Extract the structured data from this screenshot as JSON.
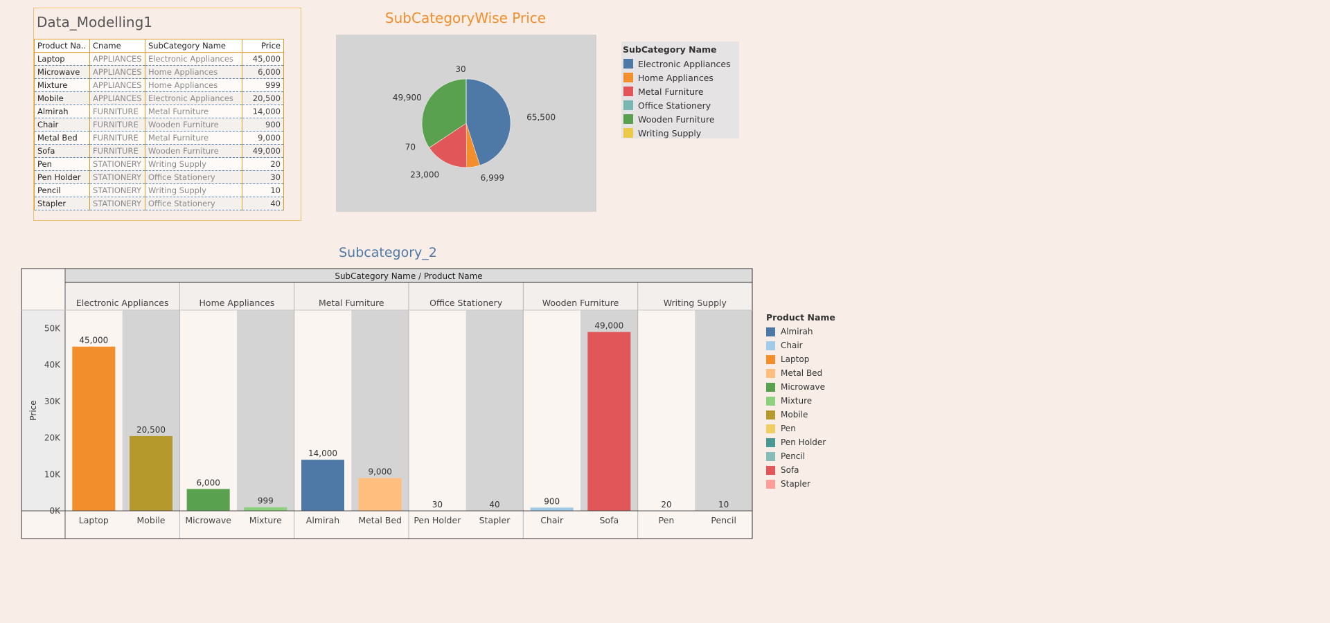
{
  "table": {
    "title": "Data_Modelling1",
    "columns": [
      "Product Na..",
      "Cname",
      "SubCategory Name",
      "Price"
    ],
    "rows": [
      [
        "Laptop",
        "APPLIANCES",
        "Electronic Appliances",
        "45,000"
      ],
      [
        "Microwave",
        "APPLIANCES",
        "Home Appliances",
        "6,000"
      ],
      [
        "Mixture",
        "APPLIANCES",
        "Home Appliances",
        "999"
      ],
      [
        "Mobile",
        "APPLIANCES",
        "Electronic Appliances",
        "20,500"
      ],
      [
        "Almirah",
        "FURNITURE",
        "Metal Furniture",
        "14,000"
      ],
      [
        "Chair",
        "FURNITURE",
        "Wooden Furniture",
        "900"
      ],
      [
        "Metal Bed",
        "FURNITURE",
        "Metal Furniture",
        "9,000"
      ],
      [
        "Sofa",
        "FURNITURE",
        "Wooden Furniture",
        "49,000"
      ],
      [
        "Pen",
        "STATIONERY",
        "Writing Supply",
        "20"
      ],
      [
        "Pen Holder",
        "STATIONERY",
        "Office Stationery",
        "30"
      ],
      [
        "Pencil",
        "STATIONERY",
        "Writing Supply",
        "10"
      ],
      [
        "Stapler",
        "STATIONERY",
        "Office Stationery",
        "40"
      ]
    ]
  },
  "pie": {
    "title": "SubCategoryWise Price",
    "legend_title": "SubCategory Name",
    "legend": [
      {
        "name": "Electronic Appliances",
        "color": "#4e79a7"
      },
      {
        "name": "Home Appliances",
        "color": "#f28e2b"
      },
      {
        "name": "Metal Furniture",
        "color": "#e15759"
      },
      {
        "name": "Office Stationery",
        "color": "#76b7b2"
      },
      {
        "name": "Wooden Furniture",
        "color": "#59a14f"
      },
      {
        "name": "Writing Supply",
        "color": "#edc948"
      }
    ]
  },
  "bars": {
    "title": "Subcategory_2",
    "header": "SubCategory Name  /  Product Name",
    "legend_title": "Product Name",
    "legend": [
      {
        "name": "Almirah",
        "color": "#4e79a7"
      },
      {
        "name": "Chair",
        "color": "#a0cbe8"
      },
      {
        "name": "Laptop",
        "color": "#f28e2b"
      },
      {
        "name": "Metal Bed",
        "color": "#ffbe7d"
      },
      {
        "name": "Microwave",
        "color": "#59a14f"
      },
      {
        "name": "Mixture",
        "color": "#8cd17d"
      },
      {
        "name": "Mobile",
        "color": "#b6992d"
      },
      {
        "name": "Pen",
        "color": "#f1ce63"
      },
      {
        "name": "Pen Holder",
        "color": "#499894"
      },
      {
        "name": "Pencil",
        "color": "#86bcb6"
      },
      {
        "name": "Sofa",
        "color": "#e15759"
      },
      {
        "name": "Stapler",
        "color": "#ff9d9a"
      }
    ]
  },
  "chart_data": [
    {
      "type": "pie",
      "title": "SubCategoryWise Price",
      "legend_title": "SubCategory Name",
      "slices": [
        {
          "name": "Electronic Appliances",
          "value": 65500,
          "label": "65,500",
          "color": "#4e79a7"
        },
        {
          "name": "Home Appliances",
          "value": 6999,
          "label": "6,999",
          "color": "#f28e2b"
        },
        {
          "name": "Metal Furniture",
          "value": 23000,
          "label": "23,000",
          "color": "#e15759"
        },
        {
          "name": "Office Stationery",
          "value": 70,
          "label": "70",
          "color": "#76b7b2"
        },
        {
          "name": "Wooden Furniture",
          "value": 49900,
          "label": "49,900",
          "color": "#59a14f"
        },
        {
          "name": "Writing Supply",
          "value": 30,
          "label": "30",
          "color": "#edc948"
        }
      ],
      "legend_placement": "right"
    },
    {
      "type": "bar",
      "title": "Subcategory_2",
      "ylabel": "Price",
      "ylim": [
        0,
        55000
      ],
      "yticks": [
        0,
        10000,
        20000,
        30000,
        40000,
        50000
      ],
      "ytick_labels": [
        "0K",
        "10K",
        "20K",
        "30K",
        "40K",
        "50K"
      ],
      "groups": [
        {
          "name": "Electronic Appliances",
          "bars": [
            {
              "product": "Laptop",
              "value": 45000,
              "label": "45,000"
            },
            {
              "product": "Mobile",
              "value": 20500,
              "label": "20,500"
            }
          ]
        },
        {
          "name": "Home Appliances",
          "bars": [
            {
              "product": "Microwave",
              "value": 6000,
              "label": "6,000"
            },
            {
              "product": "Mixture",
              "value": 999,
              "label": "999"
            }
          ]
        },
        {
          "name": "Metal Furniture",
          "bars": [
            {
              "product": "Almirah",
              "value": 14000,
              "label": "14,000"
            },
            {
              "product": "Metal Bed",
              "value": 9000,
              "label": "9,000"
            }
          ]
        },
        {
          "name": "Office Stationery",
          "bars": [
            {
              "product": "Pen Holder",
              "value": 30,
              "label": "30"
            },
            {
              "product": "Stapler",
              "value": 40,
              "label": "40"
            }
          ]
        },
        {
          "name": "Wooden Furniture",
          "bars": [
            {
              "product": "Chair",
              "value": 900,
              "label": "900"
            },
            {
              "product": "Sofa",
              "value": 49000,
              "label": "49,000"
            }
          ]
        },
        {
          "name": "Writing Supply",
          "bars": [
            {
              "product": "Pen",
              "value": 20,
              "label": "20"
            },
            {
              "product": "Pencil",
              "value": 10,
              "label": "10"
            }
          ]
        }
      ],
      "legend_title": "Product Name",
      "legend_placement": "right",
      "grid": false
    }
  ]
}
